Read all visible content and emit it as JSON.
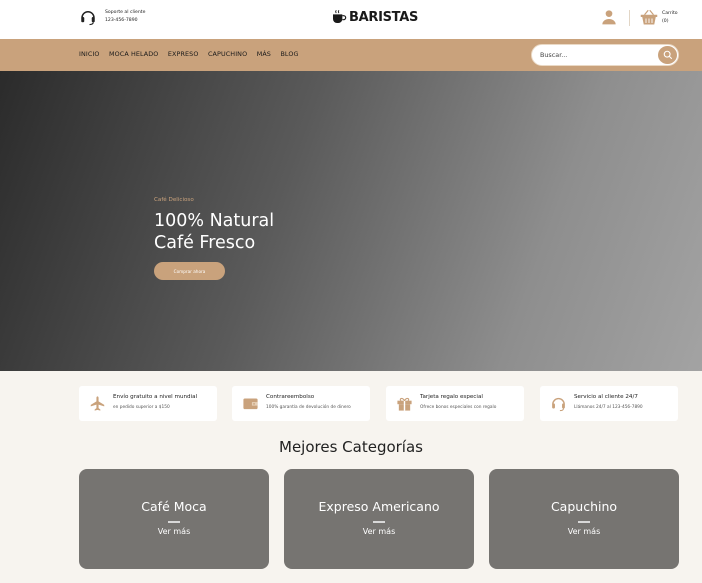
{
  "support": {
    "line1": "Soporte al cliente",
    "line2": "123-456-7890",
    "icon": "headset-icon"
  },
  "brand": {
    "name": "BARISTAS",
    "icon": "coffee-cup-icon"
  },
  "cart": {
    "label": "Carrito",
    "count": "(0)",
    "icon": "basket-icon"
  },
  "user_icon": "user-icon",
  "nav": {
    "items": [
      "INICIO",
      "MOCA HELADO",
      "EXPRESO",
      "CAPUCHINO",
      "MÁS",
      "BLOG"
    ]
  },
  "search": {
    "placeholder": "Buscar...",
    "icon": "search-icon"
  },
  "hero": {
    "kicker": "Café Delicioso",
    "title_line1": "100% Natural",
    "title_line2": "Café Fresco",
    "cta": "Comprar ahora"
  },
  "features": [
    {
      "icon": "airplane-icon",
      "title": "Envío gratuito a nivel mundial",
      "subtitle": "en pedido superior a $150"
    },
    {
      "icon": "wallet-icon",
      "title": "Contrareembolso",
      "subtitle": "100% garantía de devolución de dinero"
    },
    {
      "icon": "gift-icon",
      "title": "Tarjeta regalo especial",
      "subtitle": "Ofrece bonos especiales con regalo"
    },
    {
      "icon": "headset-icon",
      "title": "Servicio al cliente 24/7",
      "subtitle": "Llámanos 24/7 al 123-456-7890"
    }
  ],
  "categories": {
    "heading": "Mejores Categorías",
    "items": [
      {
        "name": "Café Moca",
        "more": "Ver más"
      },
      {
        "name": "Expreso Americano",
        "more": "Ver más"
      },
      {
        "name": "Capuchino",
        "more": "Ver más"
      }
    ]
  },
  "colors": {
    "accent": "#c9a27c",
    "page_bg": "#f7f4ef",
    "card_bg": "#767471"
  }
}
